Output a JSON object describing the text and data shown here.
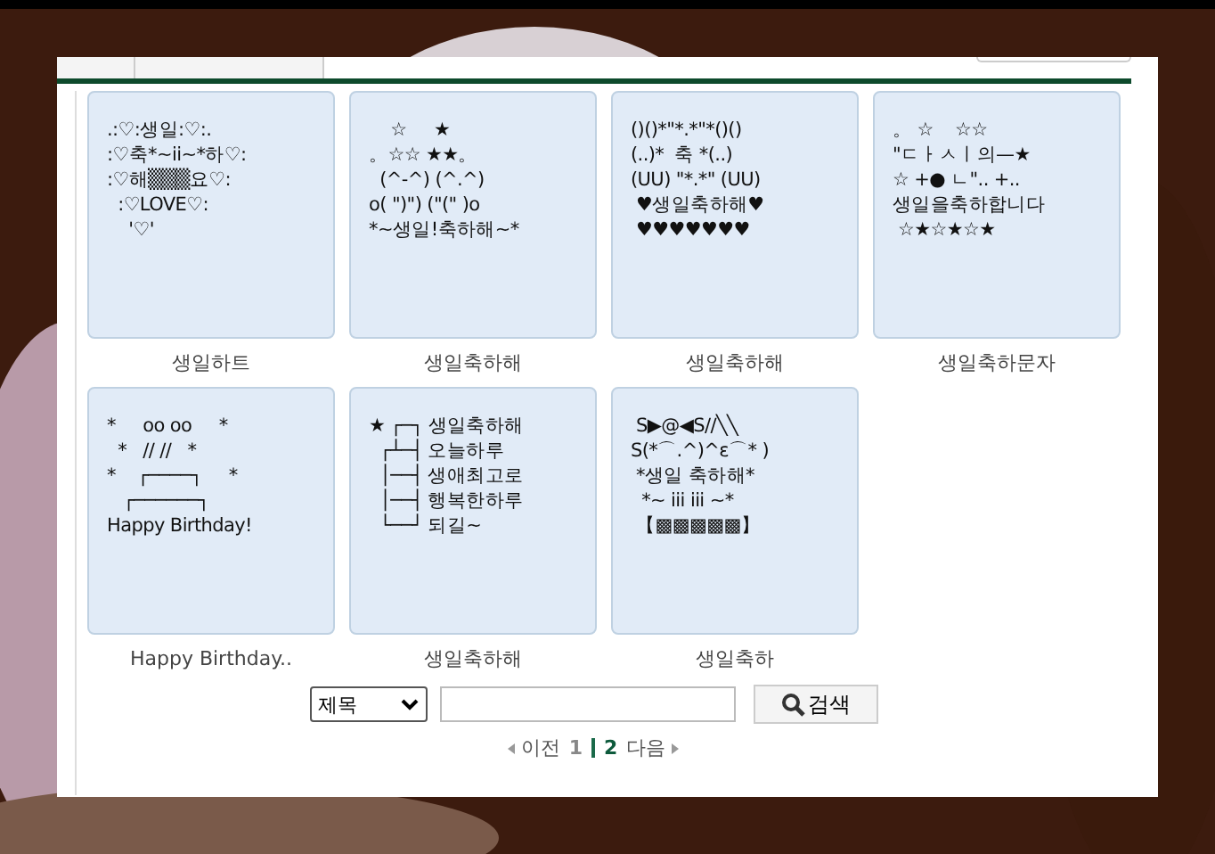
{
  "cards": [
    {
      "art": ".:♡:생일:♡:.\n:♡축*~ii~*하♡:\n:♡해▒▒▒요♡:\n  :♡LOVE♡:\n    '♡'",
      "caption": "생일하트"
    },
    {
      "art": "    ☆     ★\n。☆☆ ★★。\n  (^-^) (^.^)\no( \")\") (\"(\" )o\n*~생일!축하해~*",
      "caption": "생일축하해"
    },
    {
      "art": "()()*\"*.*\"*()()\n(..)*  축 *(..)\n(UU) \"*.*\" (UU)\n ♥생일축하해♥\n ♥♥♥♥♥♥♥",
      "caption": "생일축하해"
    },
    {
      "art": "。 ☆    ☆☆\n\"ㄷㅏㅅㅣ의—★\n☆ +● ㄴ\".. +..\n생일을축하합니다\n ☆★☆★☆★",
      "caption": "생일축하문자"
    },
    {
      "art": "*     oo oo     *\n  *   // //   *\n*    ┌────┐     *\n   ┌──────┐\nHappy Birthday!",
      "caption": "Happy Birthday.."
    },
    {
      "art": "★ ┌─┐ 생일축하해\n  ┌┴─┤ 오늘하루\n  │──┤ 생애최고로\n  │──┤ 행복한하루\n  └──┘ 되길~",
      "caption": "생일축하해"
    },
    {
      "art": " S▶@◀S//╲╲\nS(*⌒.^)^ε⌒* )\n *생일 축하해*\n  *~ iii iii ~*\n 【▩▩▩▩▩】",
      "caption": "생일축하"
    }
  ],
  "search": {
    "field": "제목",
    "button": "검색"
  },
  "pager": {
    "prev": "이전",
    "next": "다음",
    "pages": [
      {
        "label": "1",
        "selected": false
      },
      {
        "label": "2",
        "selected": true
      }
    ]
  }
}
